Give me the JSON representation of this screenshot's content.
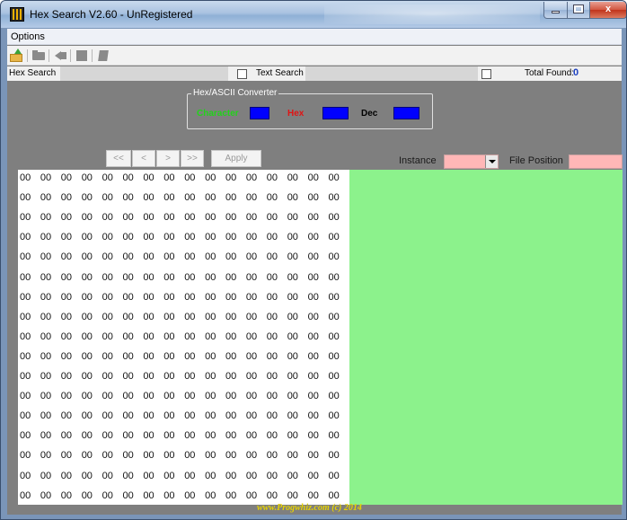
{
  "window": {
    "title": "Hex Search V2.60 - UnRegistered",
    "close_glyph": "x",
    "icons": [
      "app-icon",
      "minimize-icon",
      "maximize-icon",
      "close-icon"
    ]
  },
  "menu": {
    "items": [
      "Options"
    ]
  },
  "toolbar": {
    "icons": [
      "open-file-icon",
      "folder-icon",
      "back-icon",
      "stop-icon",
      "document-icon"
    ]
  },
  "search": {
    "hex_label": "Hex Search",
    "hex_value": "",
    "text_label": "Text Search",
    "text_value": "",
    "total_found_label": "Total Found:",
    "total_found_value": "0"
  },
  "converter": {
    "title": "Hex/ASCII Converter",
    "character_label": "Character",
    "hex_label": "Hex",
    "dec_label": "Dec",
    "character_value": "",
    "hex_value": "",
    "dec_value": ""
  },
  "navigation": {
    "first": "<<",
    "prev": "<",
    "next": ">",
    "last": ">>",
    "apply": "Apply"
  },
  "instance": {
    "label": "Instance",
    "value": ""
  },
  "file_position": {
    "label": "File Position",
    "value": ""
  },
  "hex_grid": {
    "rows": [
      [
        "00",
        "00",
        "00",
        "00",
        "00",
        "00",
        "00",
        "00",
        "00",
        "00",
        "00",
        "00",
        "00",
        "00",
        "00",
        "00"
      ],
      [
        "00",
        "00",
        "00",
        "00",
        "00",
        "00",
        "00",
        "00",
        "00",
        "00",
        "00",
        "00",
        "00",
        "00",
        "00",
        "00"
      ],
      [
        "00",
        "00",
        "00",
        "00",
        "00",
        "00",
        "00",
        "00",
        "00",
        "00",
        "00",
        "00",
        "00",
        "00",
        "00",
        "00"
      ],
      [
        "00",
        "00",
        "00",
        "00",
        "00",
        "00",
        "00",
        "00",
        "00",
        "00",
        "00",
        "00",
        "00",
        "00",
        "00",
        "00"
      ],
      [
        "00",
        "00",
        "00",
        "00",
        "00",
        "00",
        "00",
        "00",
        "00",
        "00",
        "00",
        "00",
        "00",
        "00",
        "00",
        "00"
      ],
      [
        "00",
        "00",
        "00",
        "00",
        "00",
        "00",
        "00",
        "00",
        "00",
        "00",
        "00",
        "00",
        "00",
        "00",
        "00",
        "00"
      ],
      [
        "00",
        "00",
        "00",
        "00",
        "00",
        "00",
        "00",
        "00",
        "00",
        "00",
        "00",
        "00",
        "00",
        "00",
        "00",
        "00"
      ],
      [
        "00",
        "00",
        "00",
        "00",
        "00",
        "00",
        "00",
        "00",
        "00",
        "00",
        "00",
        "00",
        "00",
        "00",
        "00",
        "00"
      ],
      [
        "00",
        "00",
        "00",
        "00",
        "00",
        "00",
        "00",
        "00",
        "00",
        "00",
        "00",
        "00",
        "00",
        "00",
        "00",
        "00"
      ],
      [
        "00",
        "00",
        "00",
        "00",
        "00",
        "00",
        "00",
        "00",
        "00",
        "00",
        "00",
        "00",
        "00",
        "00",
        "00",
        "00"
      ],
      [
        "00",
        "00",
        "00",
        "00",
        "00",
        "00",
        "00",
        "00",
        "00",
        "00",
        "00",
        "00",
        "00",
        "00",
        "00",
        "00"
      ],
      [
        "00",
        "00",
        "00",
        "00",
        "00",
        "00",
        "00",
        "00",
        "00",
        "00",
        "00",
        "00",
        "00",
        "00",
        "00",
        "00"
      ],
      [
        "00",
        "00",
        "00",
        "00",
        "00",
        "00",
        "00",
        "00",
        "00",
        "00",
        "00",
        "00",
        "00",
        "00",
        "00",
        "00"
      ],
      [
        "00",
        "00",
        "00",
        "00",
        "00",
        "00",
        "00",
        "00",
        "00",
        "00",
        "00",
        "00",
        "00",
        "00",
        "00",
        "00"
      ],
      [
        "00",
        "00",
        "00",
        "00",
        "00",
        "00",
        "00",
        "00",
        "00",
        "00",
        "00",
        "00",
        "00",
        "00",
        "00",
        "00"
      ],
      [
        "00",
        "00",
        "00",
        "00",
        "00",
        "00",
        "00",
        "00",
        "00",
        "00",
        "00",
        "00",
        "00",
        "00",
        "00",
        "00"
      ],
      [
        "00",
        "00",
        "00",
        "00",
        "00",
        "00",
        "00",
        "00",
        "00",
        "00",
        "00",
        "00",
        "00",
        "00",
        "00",
        "00"
      ]
    ]
  },
  "footer": {
    "text": "www.Progwhiz.com (c) 2014"
  },
  "colors": {
    "character_label": "#22d31a",
    "hex_label": "#e01414",
    "converter_boxes": "#0000ff",
    "total_found_value": "#1b3fc0",
    "ascii_pane": "#8cf28c",
    "instance_field": "#ffb7b7",
    "footer_text": "#e6d200",
    "background": "#7f7f7f"
  }
}
